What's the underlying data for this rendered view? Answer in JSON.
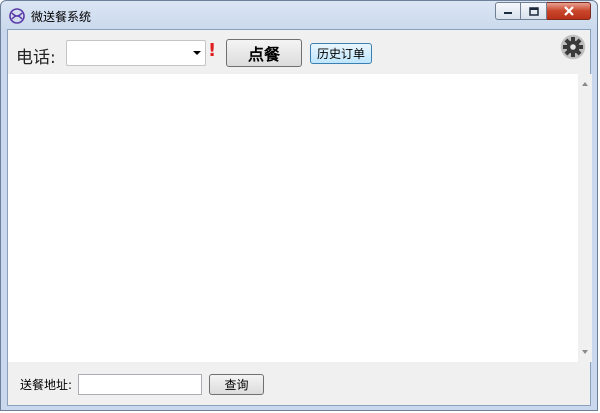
{
  "window": {
    "title": "微送餐系统",
    "icon": "app-logo-icon",
    "controls": [
      "minimize-icon",
      "maximize-icon",
      "close-icon"
    ]
  },
  "toolbar": {
    "phone_label": "电话:",
    "phone_value": "",
    "required_mark": "!",
    "order_label": "点餐",
    "history_label": "历史订单",
    "settings_icon": "gear-icon"
  },
  "footer": {
    "address_label": "送餐地址:",
    "address_value": "",
    "query_label": "查询"
  },
  "colors": {
    "required": "#e02020",
    "history_border": "#3c7fb1",
    "close_button": "#c8452a"
  }
}
